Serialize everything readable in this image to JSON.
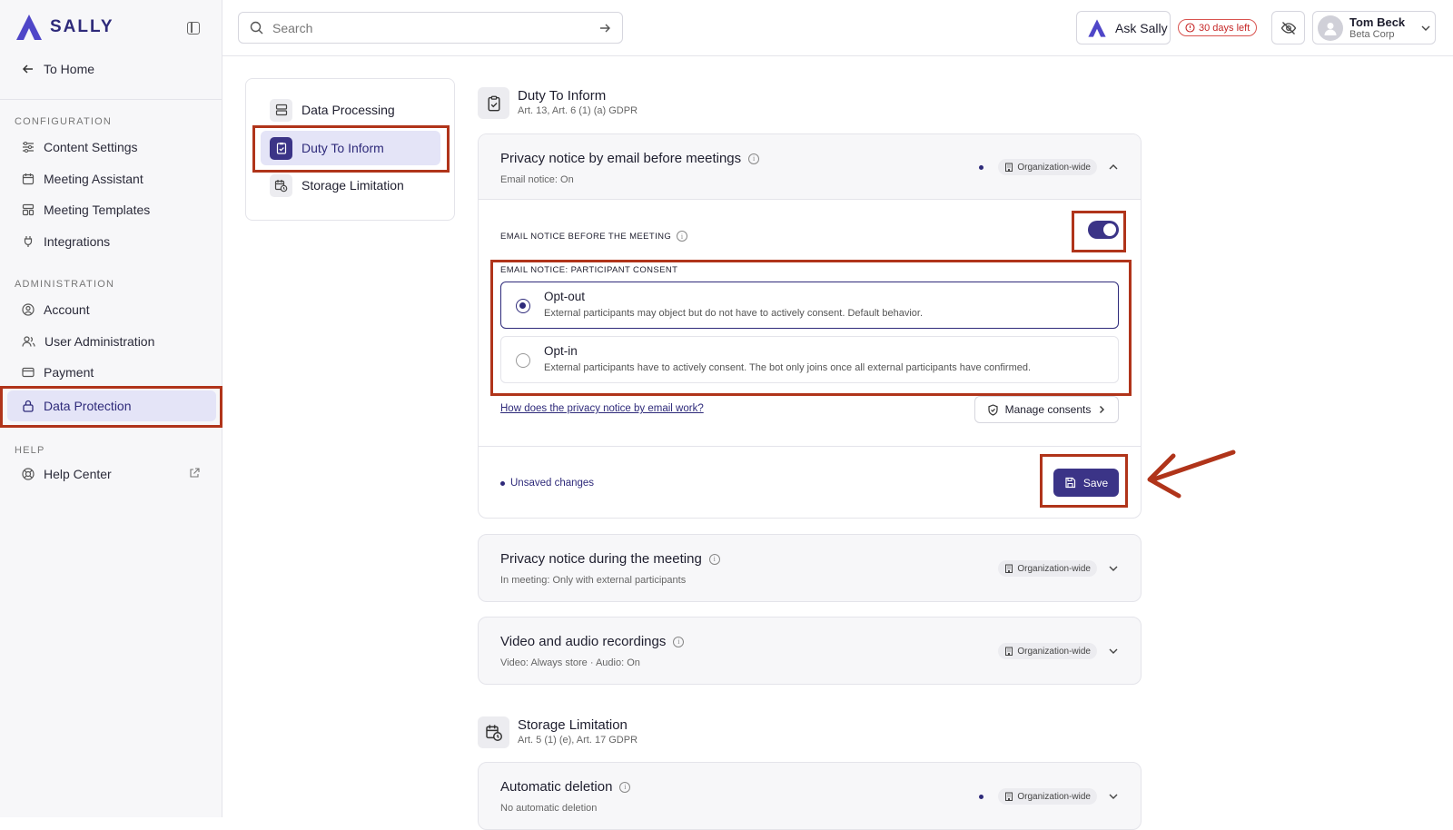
{
  "brand": {
    "name": "SALLY",
    "accent": "#3b3487",
    "highlight": "#b0341a"
  },
  "sidebar": {
    "home": "To Home",
    "sections": [
      {
        "title": "CONFIGURATION",
        "items": [
          "Content Settings",
          "Meeting Assistant",
          "Meeting Templates",
          "Integrations"
        ]
      },
      {
        "title": "ADMINISTRATION",
        "items": [
          "Account",
          "User Administration",
          "Payment",
          "Data Protection"
        ]
      },
      {
        "title": "HELP",
        "items": [
          "Help Center"
        ]
      }
    ],
    "active_item": "Data Protection"
  },
  "topbar": {
    "search_placeholder": "Search",
    "ask": "Ask Sally",
    "trial": "30 days left",
    "user": {
      "name": "Tom Beck",
      "company": "Beta Corp"
    }
  },
  "subnav": {
    "items": [
      "Data Processing",
      "Duty To Inform",
      "Storage Limitation"
    ],
    "active": "Duty To Inform"
  },
  "duty": {
    "title": "Duty To Inform",
    "subtitle": "Art. 13, Art. 6 (1) (a) GDPR",
    "cards": [
      {
        "title": "Privacy notice by email before meetings",
        "summary": "Email notice: On",
        "badge": "Organization-wide",
        "expanded": true,
        "toggle_label": "EMAIL NOTICE BEFORE THE MEETING",
        "toggle_on": true,
        "consent_label": "EMAIL NOTICE: PARTICIPANT CONSENT",
        "options": [
          {
            "title": "Opt-out",
            "desc": "External participants may object but do not have to actively consent. Default behavior.",
            "selected": true
          },
          {
            "title": "Opt-in",
            "desc": "External participants have to actively consent. The bot only joins once all external participants have confirmed.",
            "selected": false
          }
        ],
        "help_link": "How does the privacy notice by email work?",
        "manage": "Manage consents",
        "unsaved": "Unsaved changes",
        "save": "Save"
      },
      {
        "title": "Privacy notice during the meeting",
        "summary": "In meeting: Only with external participants",
        "badge": "Organization-wide"
      },
      {
        "title": "Video and audio recordings",
        "summary": "Video: Always store · Audio: On",
        "badge": "Organization-wide"
      }
    ]
  },
  "storage": {
    "title": "Storage Limitation",
    "subtitle": "Art. 5 (1) (e), Art. 17 GDPR",
    "cards": [
      {
        "title": "Automatic deletion",
        "summary": "No automatic deletion",
        "badge": "Organization-wide"
      }
    ]
  }
}
